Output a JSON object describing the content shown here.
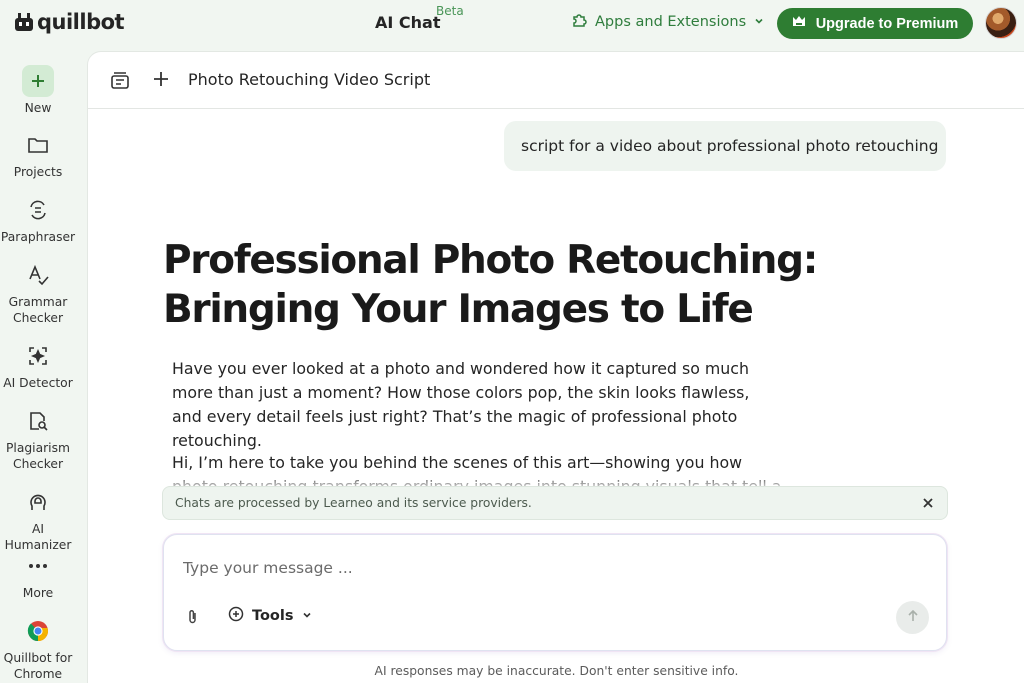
{
  "app": {
    "logo_text": "quillbot",
    "title": "AI Chat",
    "beta": "Beta"
  },
  "header": {
    "apps_label": "Apps and Extensions",
    "upgrade_label": "Upgrade to Premium"
  },
  "sidebar": {
    "items": [
      {
        "label": "New",
        "icon": "plus-icon"
      },
      {
        "label": "Projects",
        "icon": "folder-icon"
      },
      {
        "label": "Paraphraser",
        "icon": "paraphraser-icon"
      },
      {
        "label": "Grammar Checker",
        "icon": "grammar-icon"
      },
      {
        "label": "AI Detector",
        "icon": "ai-detector-icon"
      },
      {
        "label": "Plagiarism Checker",
        "icon": "plagiarism-icon"
      },
      {
        "label": "AI Humanizer",
        "icon": "humanizer-icon"
      },
      {
        "label": "More",
        "icon": "more-icon"
      },
      {
        "label": "Quillbot for Chrome",
        "icon": "chrome-icon"
      }
    ]
  },
  "chat": {
    "title": "Photo Retouching Video Script",
    "user_message": "script for a video about professional photo retouching",
    "ai_heading": "Professional Photo Retouching: Bringing Your Images to Life",
    "ai_paragraphs": [
      "Have you ever looked at a photo and wondered how it captured so much more than just a moment? How those colors pop, the skin looks flawless, and every detail feels just right? That’s the magic of professional photo retouching.",
      "Hi, I’m here to take you behind the scenes of this art—showing you how photo retouching transforms ordinary images into stunning visuals that tell a story."
    ],
    "notice": "Chats are processed by Learneo and its service providers.",
    "composer": {
      "placeholder": "Type your message ...",
      "tools_label": "Tools"
    },
    "disclaimer": "AI responses may be inaccurate. Don't enter sensitive info."
  },
  "colors": {
    "brand_green": "#2e7d32",
    "accent_green": "#499557",
    "background": "#f1f6f1"
  }
}
